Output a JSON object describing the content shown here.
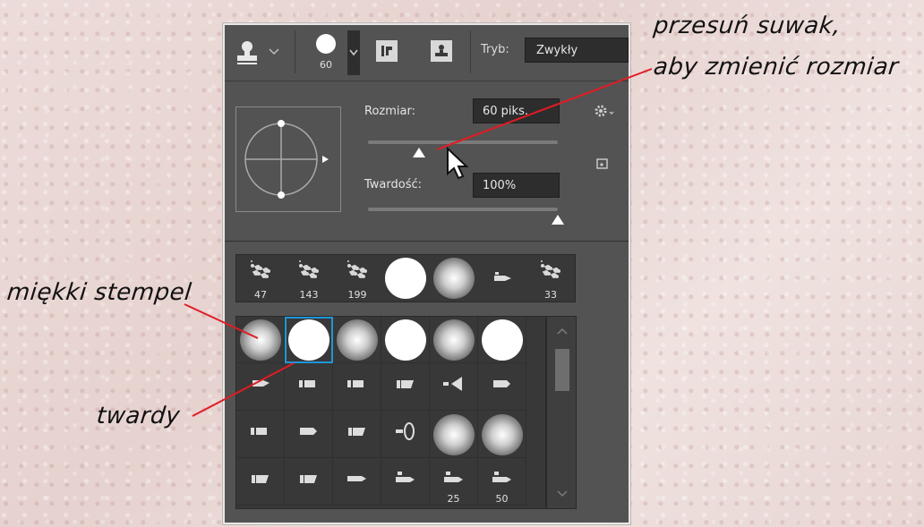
{
  "annotations": {
    "slider_line1": "przesuń suwak,",
    "slider_line2": "aby zmienić rozmiar",
    "soft_brush": "miękki stempel",
    "hard_brush": "twardy"
  },
  "toolbar": {
    "brush_size": "60",
    "mode_label": "Tryb:",
    "mode_value": "Zwykły"
  },
  "brush_options": {
    "size_label": "Rozmiar:",
    "size_value": "60 piks.",
    "size_fraction": 0.27,
    "hardness_label": "Twardość:",
    "hardness_value": "100%",
    "hardness_fraction": 1.0
  },
  "recent_presets": [
    "47",
    "143",
    "199",
    "",
    "",
    "",
    "33"
  ],
  "grid_numbers": {
    "r4c5": "25",
    "r4c6": "50"
  },
  "colors": {
    "accent": "#1f97d9",
    "panel": "#535353",
    "annotation_line": "#e01c24"
  }
}
